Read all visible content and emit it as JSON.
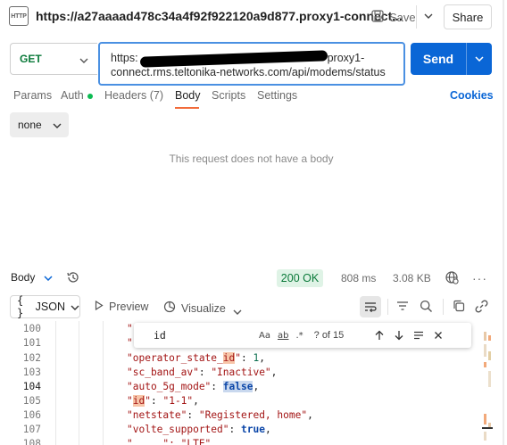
{
  "header": {
    "http_badge": "HTTP",
    "title": "https://a27aaaad478c34a4f92f922120a9d877.proxy1-connect...",
    "save_label": "Save",
    "share_label": "Share"
  },
  "request": {
    "method": "GET",
    "url_line1_prefix": "https:",
    "url_line1_suffix": "proxy1-",
    "url_line2": "connect.rms.teltonika-networks.com/api/modems/status",
    "send_label": "Send"
  },
  "tabs": [
    {
      "label": "Params"
    },
    {
      "label": "Auth"
    },
    {
      "label": "Headers (7)"
    },
    {
      "label": "Body"
    },
    {
      "label": "Scripts"
    },
    {
      "label": "Settings"
    }
  ],
  "cookies_label": "Cookies",
  "body_type": "none",
  "no_body_text": "This request does not have a body",
  "response": {
    "section_label": "Body",
    "status": "200 OK",
    "time": "808 ms",
    "size": "3.08 KB",
    "more": "···"
  },
  "toolbar": {
    "format": "JSON",
    "preview": "Preview",
    "visualize": "Visualize"
  },
  "find": {
    "query": "id",
    "opt_case": "Aa",
    "opt_word": "ab",
    "opt_regex": ".*",
    "count": "? of 15"
  },
  "code": {
    "current_line": 104,
    "lines": [
      {
        "num": "100",
        "text": "\""
      },
      {
        "num": "101",
        "text": "\""
      },
      {
        "num": "102",
        "text": "\"operator_state_id\": 1,"
      },
      {
        "num": "103",
        "text": "\"sc_band_av\": \"Inactive\","
      },
      {
        "num": "104",
        "text": "\"auto_5g_mode\": false,"
      },
      {
        "num": "105",
        "text": "\"id\": \"1-1\","
      },
      {
        "num": "106",
        "text": "\"netstate\": \"Registered, home\","
      },
      {
        "num": "107",
        "text": "\"volte_supported\": true,"
      }
    ]
  },
  "colors": {
    "accent_blue": "#0a66d6",
    "get_green": "#0b7a3a",
    "active_tab_underline": "#f26b3a",
    "status_ok_bg": "#dff3e6",
    "match_highlight": "#f7c5a8"
  }
}
